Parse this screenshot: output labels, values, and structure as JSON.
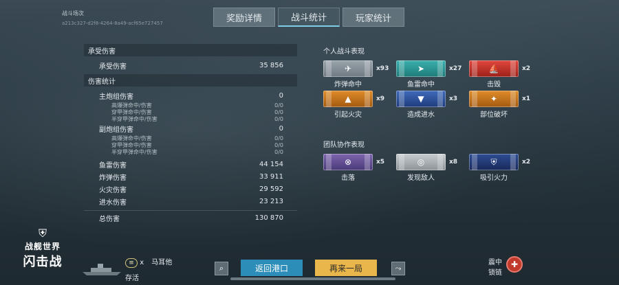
{
  "header": {
    "battle_label": "战斗场次",
    "battle_uuid": "a213c327-d2f8-4264-8a49-acf65e727457",
    "tabs": [
      "奖励详情",
      "战斗统计",
      "玩家统计"
    ]
  },
  "left": {
    "received": {
      "title": "承受伤害",
      "label": "承受伤害",
      "value": "35 856"
    },
    "damage": {
      "title": "伤害统计",
      "main": {
        "label": "主炮组伤害",
        "value": "0"
      },
      "main_sub": [
        {
          "label": "高爆弹命中/伤害",
          "value": "0/0"
        },
        {
          "label": "穿甲弹命中/伤害",
          "value": "0/0"
        },
        {
          "label": "半穿甲弹命中/伤害",
          "value": "0/0"
        }
      ],
      "secondary": {
        "label": "副炮组伤害",
        "value": "0"
      },
      "secondary_sub": [
        {
          "label": "高爆弹命中/伤害",
          "value": "0/0"
        },
        {
          "label": "穿甲弹命中/伤害",
          "value": "0/0"
        },
        {
          "label": "半穿甲弹命中/伤害",
          "value": "0/0"
        }
      ],
      "others": [
        {
          "label": "鱼雷伤害",
          "value": "44 154"
        },
        {
          "label": "炸弹伤害",
          "value": "33 911"
        },
        {
          "label": "火灾伤害",
          "value": "29 592"
        },
        {
          "label": "进水伤害",
          "value": "23 213"
        }
      ],
      "total": {
        "label": "总伤害",
        "value": "130 870"
      }
    }
  },
  "right": {
    "personal": {
      "title": "个人战斗表现",
      "medals": [
        {
          "label": "炸弹命中",
          "count": "x93",
          "color": "#8a949b",
          "icon": "bomb-icon"
        },
        {
          "label": "鱼雷命中",
          "count": "x27",
          "color": "#2d9896",
          "icon": "torpedo-icon"
        },
        {
          "label": "击毁",
          "count": "x2",
          "color": "#c6352c",
          "icon": "ship-sinking-icon"
        },
        {
          "label": "引起火灾",
          "count": "x9",
          "color": "#cc7a20",
          "icon": "fire-icon"
        },
        {
          "label": "造成进水",
          "count": "x3",
          "color": "#2e5aa6",
          "icon": "flooding-icon"
        },
        {
          "label": "部位破坏",
          "count": "x1",
          "color": "#cc7a20",
          "icon": "module-damage-icon"
        }
      ]
    },
    "team": {
      "title": "团队协作表现",
      "medals": [
        {
          "label": "击落",
          "count": "x5",
          "color": "#6a56a0",
          "icon": "crosshair-icon"
        },
        {
          "label": "发现敌人",
          "count": "x8",
          "color": "#aab1b6",
          "icon": "radar-icon"
        },
        {
          "label": "吸引火力",
          "count": "x2",
          "color": "#24407f",
          "icon": "tank-fire-icon"
        }
      ]
    }
  },
  "footer": {
    "logo_line1": "战舰世界",
    "logo_line2": "闪击战",
    "player_rank": "x",
    "player_name": "马耳他",
    "player_status": "存活",
    "back_label": "返回港口",
    "again_label": "再来一局",
    "reward_line1": "震中",
    "reward_line2": "锁链"
  }
}
